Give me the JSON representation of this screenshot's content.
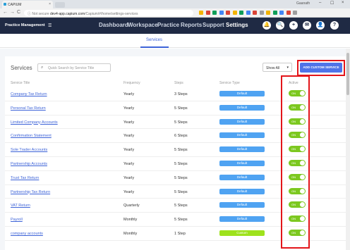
{
  "browser": {
    "tab_title": "CAPIUM",
    "tab_close": "×",
    "profile": "Gaanath",
    "window_controls": [
      "–",
      "☐",
      "×"
    ],
    "nav": [
      "←",
      "→",
      "C"
    ],
    "not_secure": "ⓘ Not secure",
    "url_domain": "dev4-app.capium.com",
    "url_path": "/Capium/#/home/settings-services",
    "extension_colors": [
      "#f4b400",
      "#db4437",
      "#0f9d58",
      "#4285f4",
      "#db4437",
      "#f4b400",
      "#0f9d58",
      "#4285f4",
      "#db4437",
      "#9e9e9e",
      "#f4b400",
      "#0f9d58",
      "#4285f4",
      "#db4437",
      "#9e9e9e"
    ]
  },
  "header": {
    "brand": "Practice Management",
    "menu_icon": "☰",
    "nav": [
      "Dashboard",
      "Workspace",
      "Practice",
      "Reports",
      "Support",
      "Settings"
    ],
    "active_nav": "Settings",
    "icons": [
      "🔔",
      "🔍",
      "+",
      "✉",
      "👤",
      "?"
    ]
  },
  "subnav": {
    "tab": "Services"
  },
  "toolbar": {
    "title": "Services",
    "search_placeholder": "Quick Search by Service Title",
    "search_icon": "⌕",
    "filter_value": "Show All",
    "filter_chevron": "▾",
    "add_button": "ADD CUSTOM SERVICE"
  },
  "table": {
    "headers": [
      "Service Title",
      "Frequency",
      "Steps",
      "Service Type",
      "Active"
    ],
    "rows": [
      {
        "title": "Company Tax Return",
        "frequency": "Yearly",
        "steps": "3 Steps",
        "type": "Default",
        "active": "ON"
      },
      {
        "title": "Personal Tax Return",
        "frequency": "Yearly",
        "steps": "5 Steps",
        "type": "Default",
        "active": "ON"
      },
      {
        "title": "Limited Company Accounts",
        "frequency": "Yearly",
        "steps": "5 Steps",
        "type": "Default",
        "active": "ON"
      },
      {
        "title": "Confirmation Statement",
        "frequency": "Yearly",
        "steps": "6 Steps",
        "type": "Default",
        "active": "ON"
      },
      {
        "title": "Sole Trader Accounts",
        "frequency": "Yearly",
        "steps": "5 Steps",
        "type": "Default",
        "active": "ON"
      },
      {
        "title": "Partnership Accounts",
        "frequency": "Yearly",
        "steps": "5 Steps",
        "type": "Default",
        "active": "ON"
      },
      {
        "title": "Trust Tax Return",
        "frequency": "Yearly",
        "steps": "5 Steps",
        "type": "Default",
        "active": "ON"
      },
      {
        "title": "Partnership Tax Return",
        "frequency": "Yearly",
        "steps": "5 Steps",
        "type": "Default",
        "active": "ON"
      },
      {
        "title": "VAT Return",
        "frequency": "Quarterly",
        "steps": "5 Steps",
        "type": "Default",
        "active": "ON"
      },
      {
        "title": "Payroll",
        "frequency": "Monthly",
        "steps": "5 Steps",
        "type": "Default",
        "active": "ON"
      },
      {
        "title": "company accounts",
        "frequency": "Monthly",
        "steps": "1 Step",
        "type": "Custom",
        "active": "ON"
      }
    ]
  },
  "colors": {
    "default_type": "#4fa3f2",
    "custom_type": "#9ee21c",
    "toggle_on": "#7cc81f",
    "highlight": "#e3151a",
    "accent": "#4f73e8"
  }
}
